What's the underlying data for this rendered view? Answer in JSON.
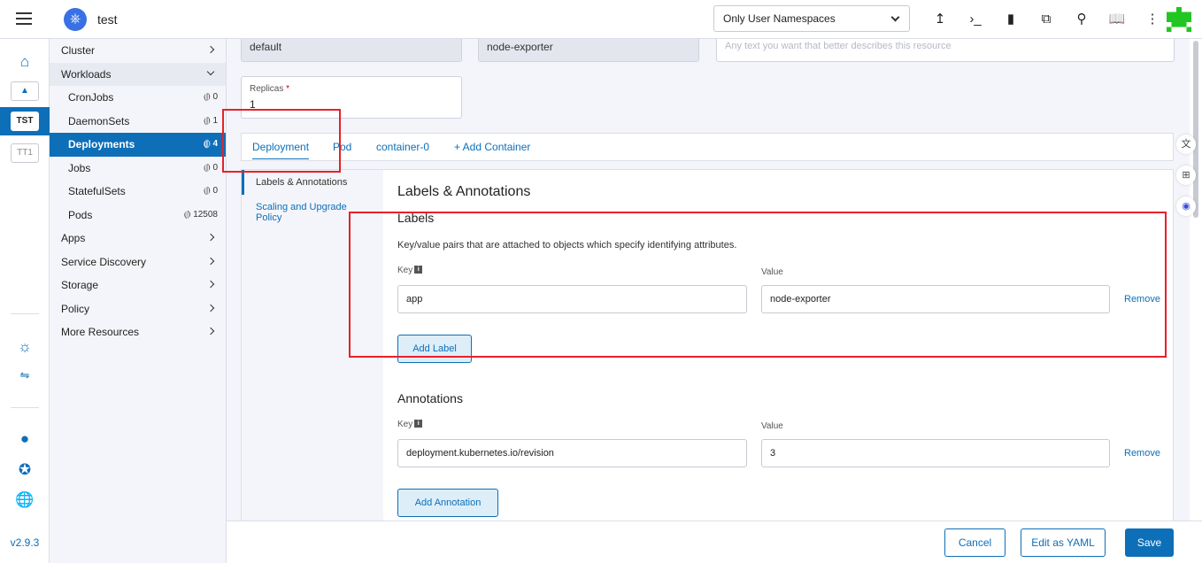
{
  "header": {
    "cluster_name": "test",
    "namespace_filter": "Only User Namespaces",
    "icons": [
      "upload-icon",
      "terminal-icon",
      "file-icon",
      "copy-icon",
      "search-icon",
      "book-icon",
      "more-vert-icon"
    ]
  },
  "rail": {
    "badge_active": "TST",
    "badge_other": "TT1",
    "version": "v2.9.3"
  },
  "sidebar": {
    "groups": [
      {
        "label": "Cluster"
      },
      {
        "label": "Workloads"
      }
    ],
    "workload_items": [
      {
        "label": "CronJobs",
        "count": "0"
      },
      {
        "label": "DaemonSets",
        "count": "1"
      },
      {
        "label": "Deployments",
        "count": "4"
      },
      {
        "label": "Jobs",
        "count": "0"
      },
      {
        "label": "StatefulSets",
        "count": "0"
      },
      {
        "label": "Pods",
        "count": "12508"
      }
    ],
    "lower_groups": [
      {
        "label": "Apps"
      },
      {
        "label": "Service Discovery"
      },
      {
        "label": "Storage"
      },
      {
        "label": "Policy"
      },
      {
        "label": "More Resources"
      }
    ]
  },
  "form": {
    "namespace_value": "default",
    "name_value": "node-exporter",
    "description_placeholder": "Any text you want that better describes this resource",
    "replicas_label": "Replicas",
    "replicas_required": "*",
    "replicas_value": "1"
  },
  "tabs": {
    "deployment": "Deployment",
    "pod": "Pod",
    "container": "container-0",
    "add_container": "+ Add Container"
  },
  "sub_nav": {
    "labels_annotations": "Labels & Annotations",
    "scaling": "Scaling and Upgrade Policy"
  },
  "labels_section": {
    "title": "Labels & Annotations",
    "labels_heading": "Labels",
    "labels_help": "Key/value pairs that are attached to objects which specify identifying attributes.",
    "key_label": "Key",
    "value_label": "Value",
    "label_key": "app",
    "label_value": "node-exporter",
    "remove": "Remove",
    "add_label": "Add Label",
    "annotations_heading": "Annotations",
    "annotation_key": "deployment.kubernetes.io/revision",
    "annotation_value": "3",
    "add_annotation": "Add Annotation"
  },
  "footer": {
    "cancel": "Cancel",
    "edit_yaml": "Edit as YAML",
    "save": "Save"
  },
  "colors": {
    "accent": "#0d6fb8",
    "annotation_red": "#e8202a"
  }
}
